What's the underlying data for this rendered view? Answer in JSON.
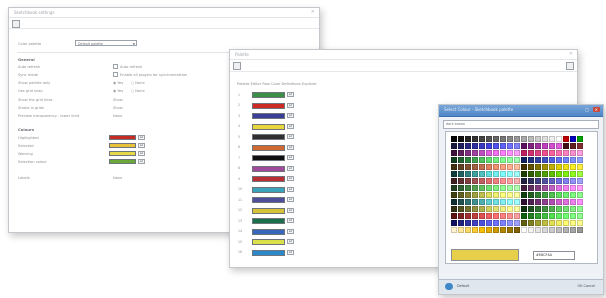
{
  "window1": {
    "title": "Sketchbook settings",
    "dropdown_label": "Color palette",
    "dropdown_value": "Default palette",
    "general": {
      "heading": "General",
      "rows": [
        {
          "label": "Auto refresh",
          "value": "Auto refresh"
        },
        {
          "label": "Sync mode",
          "value": "Enable all plugins for synchronization"
        },
        {
          "label": "Show palette only",
          "radio1": "Yes",
          "radio2": "None"
        },
        {
          "label": "Use grid snap",
          "radio1": "Yes",
          "radio2": "None"
        },
        {
          "label": "Show the grid lines",
          "value": "Show"
        },
        {
          "label": "Stroke in grids",
          "value": "Show"
        },
        {
          "label": "Preview transparency - lower limit",
          "value": "None"
        }
      ]
    },
    "colors": {
      "heading": "Colours",
      "rows": [
        {
          "label": "Highlighted",
          "color": "#c42b22",
          "btn": "ed"
        },
        {
          "label": "Selected",
          "color": "#e8c13a",
          "btn": "ed"
        },
        {
          "label": "Warning",
          "color": "#e6d84a",
          "btn": "ed"
        },
        {
          "label": "Selection colour",
          "color": "#6aa83a",
          "btn": "ed"
        }
      ]
    },
    "footer": {
      "label": "Labels",
      "value": "None"
    }
  },
  "window2": {
    "title": "Palette",
    "header": "Palette Editor Row Color Definitions Explorer",
    "rows": [
      {
        "num": "1",
        "color": "#3d8f47",
        "btn": "ed"
      },
      {
        "num": "2",
        "color": "#cc2a24",
        "btn": "ed"
      },
      {
        "num": "3",
        "color": "#3c3f97",
        "btn": "ed"
      },
      {
        "num": "4",
        "color": "#e9d63f",
        "btn": "ed"
      },
      {
        "num": "5",
        "color": "#2f2f2f",
        "btn": "ed"
      },
      {
        "num": "6",
        "color": "#cf6a32",
        "btn": "ed"
      },
      {
        "num": "7",
        "color": "#0f0f0f",
        "btn": "ed"
      },
      {
        "num": "8",
        "color": "#a14a9b",
        "btn": "ed"
      },
      {
        "num": "9",
        "color": "#ba2f34",
        "btn": "ed"
      },
      {
        "num": "10",
        "color": "#3aa3b8",
        "btn": "ed"
      },
      {
        "num": "11",
        "color": "#4e4e9a",
        "btn": "ed"
      },
      {
        "num": "12",
        "color": "#d6c238",
        "btn": "ed"
      },
      {
        "num": "13",
        "color": "#1c6f4a",
        "btn": "ed"
      },
      {
        "num": "14",
        "color": "#3667b8",
        "btn": "ed"
      },
      {
        "num": "15",
        "color": "#d9e04a",
        "btn": "ed"
      },
      {
        "num": "16",
        "color": "#2c89c9",
        "btn": "ed"
      }
    ]
  },
  "window3": {
    "title": "Select Colour - Sketchbook palette",
    "search_value": "dark brown",
    "preview_color": "#e8cf4a",
    "hex_value": "#E8CF4A",
    "footer_left": "Default",
    "footer_right": "OK  Cancel",
    "palette_hue_rows": [
      [
        "#000000",
        "#111111",
        "#222222",
        "#333333",
        "#444444",
        "#555555",
        "#666666",
        "#777777",
        "#888888",
        "#999999",
        "#aaaaaa",
        "#bbbbbb",
        "#cccccc",
        "#dddddd",
        "#eeeeee",
        "#ffffff",
        "#c00000",
        "#0000c0",
        "#00a000"
      ],
      [
        "#1a1a40",
        "#202060",
        "#282880",
        "#3030a0",
        "#3838c0",
        "#4040e0",
        "#5050f0",
        "#6060ff",
        "#7070ff",
        "#8080ff",
        "#601060",
        "#802080",
        "#a030a0",
        "#c040c0",
        "#d050d0",
        "#e060e0",
        "#401010",
        "#602020",
        "#803030"
      ],
      [
        "#401040",
        "#602060",
        "#803080",
        "#a040a0",
        "#c050c0",
        "#e060e0",
        "#f070f0",
        "#ff80ff",
        "#ff90ff",
        "#ffa0ff",
        "#c02060",
        "#d03070",
        "#e04080",
        "#f05090",
        "#ff60a0",
        "#ff70b0",
        "#ff80c0",
        "#ff90d0",
        "#ffa0e0"
      ],
      [
        "#104020",
        "#206030",
        "#308040",
        "#40a050",
        "#50c060",
        "#60e070",
        "#70f080",
        "#80ff90",
        "#90ffa0",
        "#a0ffb0",
        "#102060",
        "#203080",
        "#3040a0",
        "#4050c0",
        "#5060e0",
        "#6070f0",
        "#7080ff",
        "#8090ff",
        "#90a0ff"
      ],
      [
        "#403010",
        "#604020",
        "#805030",
        "#a06040",
        "#c07050",
        "#e08060",
        "#f09070",
        "#ffa080",
        "#ffb090",
        "#ffc0a0",
        "#403000",
        "#605000",
        "#807000",
        "#a09000",
        "#c0b000",
        "#e0d000",
        "#f0e010",
        "#fff020",
        "#fff040"
      ],
      [
        "#104040",
        "#206060",
        "#308080",
        "#40a0a0",
        "#50c0c0",
        "#60e0e0",
        "#70f0f0",
        "#80ffff",
        "#90ffff",
        "#a0ffff",
        "#204000",
        "#306000",
        "#408000",
        "#50a000",
        "#60c000",
        "#70e000",
        "#80f010",
        "#90ff20",
        "#a0ff40"
      ],
      [
        "#402020",
        "#603030",
        "#804040",
        "#a05050",
        "#c06060",
        "#e07070",
        "#f08080",
        "#ff9090",
        "#ffa0a0",
        "#ffb0b0",
        "#202040",
        "#303060",
        "#404080",
        "#5050a0",
        "#6060c0",
        "#7070e0",
        "#8080f0",
        "#9090ff",
        "#a0a0ff"
      ],
      [
        "#204020",
        "#306030",
        "#408040",
        "#50a050",
        "#60c060",
        "#70e070",
        "#80f080",
        "#90ff90",
        "#a0ffa0",
        "#b0ffb0",
        "#402040",
        "#603060",
        "#804080",
        "#a050a0",
        "#c060c0",
        "#e070e0",
        "#f080f0",
        "#ff90ff",
        "#ffa0ff"
      ],
      [
        "#404010",
        "#606020",
        "#808030",
        "#a0a040",
        "#c0c050",
        "#e0e060",
        "#f0f070",
        "#ffff80",
        "#ffff90",
        "#ffffa0",
        "#104010",
        "#206020",
        "#308030",
        "#40a040",
        "#50c050",
        "#60e060",
        "#70f070",
        "#80ff80",
        "#90ff90"
      ],
      [
        "#103030",
        "#205050",
        "#307070",
        "#409090",
        "#50b0b0",
        "#60d0d0",
        "#70e0e0",
        "#80f0f0",
        "#90ffff",
        "#a0ffff",
        "#301030",
        "#502050",
        "#703070",
        "#904090",
        "#b050b0",
        "#d060d0",
        "#e070e0",
        "#f080f0",
        "#ff90ff"
      ],
      [
        "#303010",
        "#505020",
        "#707030",
        "#909040",
        "#b0b050",
        "#d0d060",
        "#e0e070",
        "#f0f080",
        "#ffff90",
        "#ffffa0",
        "#103010",
        "#205020",
        "#307030",
        "#409040",
        "#50b050",
        "#60d060",
        "#70e070",
        "#80f080",
        "#90ff90"
      ],
      [
        "#601010",
        "#802020",
        "#a03030",
        "#c04040",
        "#e05050",
        "#f06060",
        "#ff7070",
        "#ff8080",
        "#ff9090",
        "#ffa0a0",
        "#106010",
        "#208020",
        "#30a030",
        "#40c040",
        "#50e050",
        "#60f060",
        "#70ff70",
        "#80ff80",
        "#90ff90"
      ],
      [
        "#101060",
        "#202080",
        "#3030a0",
        "#4040c0",
        "#5050e0",
        "#6060f0",
        "#7070ff",
        "#8080ff",
        "#9090ff",
        "#a0a0ff",
        "#606010",
        "#808020",
        "#a0a030",
        "#c0c040",
        "#e0e050",
        "#f0f060",
        "#ffff70",
        "#ffff80",
        "#ffff90"
      ],
      [
        "#fff2cc",
        "#ffe699",
        "#ffd966",
        "#ffcc33",
        "#ffbf00",
        "#e6ac00",
        "#cc9900",
        "#b38600",
        "#997300",
        "#806000",
        "#ffffff",
        "#f2f2f2",
        "#e6e6e6",
        "#d9d9d9",
        "#cccccc",
        "#bfbfbf",
        "#b3b3b3",
        "#a6a6a6",
        "#999999"
      ]
    ]
  }
}
